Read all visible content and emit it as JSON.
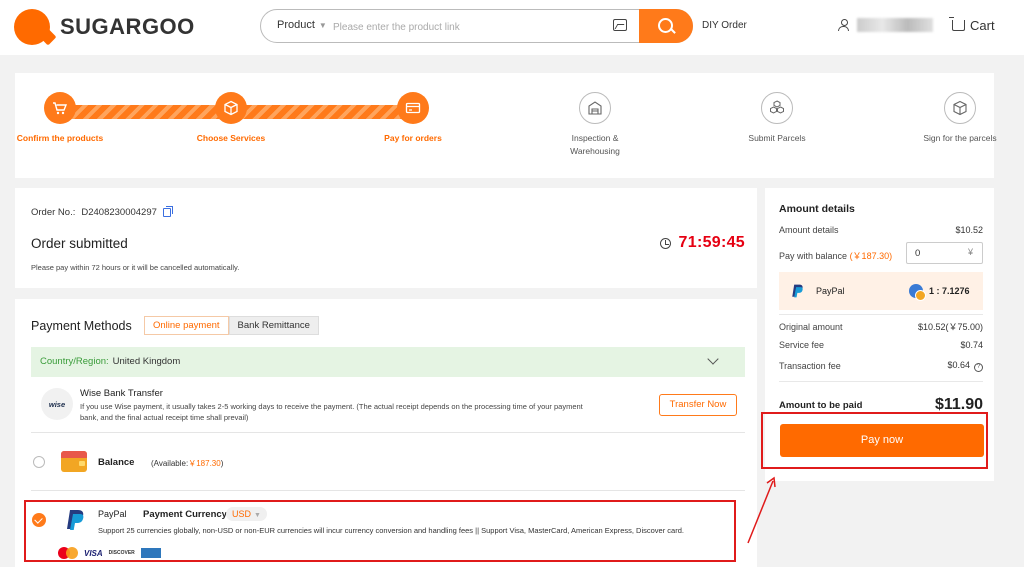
{
  "header": {
    "logo_text": "SUGARGOO",
    "search_type": "Product",
    "search_placeholder": "Please enter the product link",
    "diy_order": "DIY Order",
    "cart_label": "Cart"
  },
  "steps": [
    {
      "label": "Confirm the products",
      "status": "done",
      "icon": "cart-icon"
    },
    {
      "label": "Choose Services",
      "status": "done",
      "icon": "box-icon"
    },
    {
      "label": "Pay for orders",
      "status": "done",
      "icon": "card-icon"
    },
    {
      "label": "Inspection & Warehousing",
      "status": "todo",
      "icon": "warehouse-icon"
    },
    {
      "label": "Submit Parcels",
      "status": "todo",
      "icon": "parcels-icon"
    },
    {
      "label": "Sign for the parcels",
      "status": "todo",
      "icon": "package-icon"
    }
  ],
  "order": {
    "number_label": "Order No.:",
    "number": "D2408230004297",
    "title": "Order submitted",
    "subtitle": "Please pay within 72 hours or it will be cancelled automatically.",
    "countdown": "71:59:45"
  },
  "payment": {
    "title": "Payment Methods",
    "tabs": [
      "Online payment",
      "Bank Remittance"
    ],
    "active_tab": "Online payment",
    "country_label": "Country/Region:",
    "country_value": "United Kingdom",
    "wise": {
      "logo": "wise",
      "title": "Wise Bank Transfer",
      "desc": "If you use Wise payment, it usually takes 2-5 working days to receive the payment. (The actual receipt depends on the processing time of your payment bank, and the final actual receipt time shall prevail)",
      "button": "Transfer Now"
    },
    "balance": {
      "label": "Balance",
      "available_prefix": "(Available:",
      "available_amount": "￥187.30",
      "available_suffix": ")"
    },
    "paypal": {
      "name": "PayPal",
      "currency_label": "Payment Currency:",
      "currency": "USD",
      "desc": "Support 25 currencies globally, non-USD or non-EUR currencies will incur currency conversion and handling fees || Support Visa, MasterCard, American Express, Discover card.",
      "selected": true
    },
    "card_logos": {
      "visa": "VISA",
      "discover": "DISCOVER",
      "amex": "AMERICAN EXPRESS"
    }
  },
  "amount": {
    "title": "Amount details",
    "details_label": "Amount details",
    "details_value": "$10.52",
    "balance_label": "Pay with balance",
    "balance_available": "(￥187.30)",
    "balance_input": "0",
    "balance_unit": "¥",
    "method_name": "PayPal",
    "rate": "1 : 7.1276",
    "original_label": "Original amount",
    "original_value": "$10.52(￥75.00)",
    "service_label": "Service fee",
    "service_value": "$0.74",
    "transaction_label": "Transaction fee",
    "transaction_value": "$0.64",
    "total_label": "Amount to be paid",
    "total_value": "$11.90",
    "pay_button": "Pay now"
  },
  "colors": {
    "accent": "#ff6a00",
    "highlight": "#e01b1b",
    "country_bg": "#e5f4e3",
    "countdown": "#e60012"
  }
}
